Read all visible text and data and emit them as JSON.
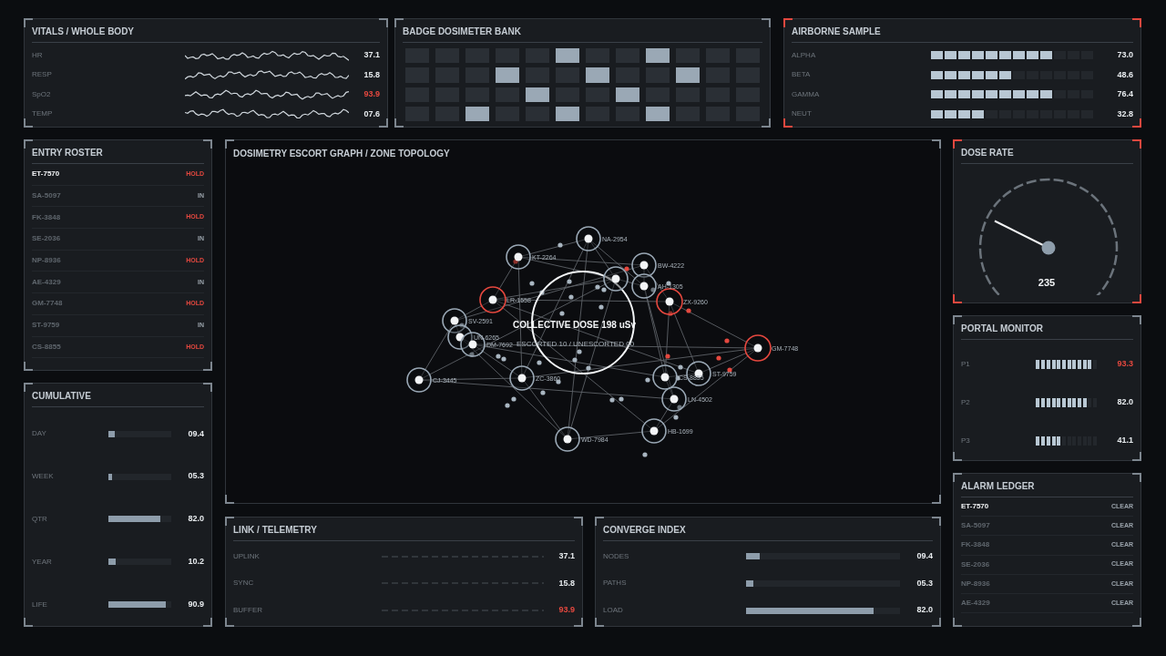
{
  "vitals": {
    "title": "VITALS / WHOLE BODY",
    "alert": false,
    "rows": [
      {
        "label": "HR",
        "value": "37.1",
        "alert": false
      },
      {
        "label": "RESP",
        "value": "15.8",
        "alert": false
      },
      {
        "label": "SpO2",
        "value": "93.9",
        "alert": true
      },
      {
        "label": "TEMP",
        "value": "07.6",
        "alert": false
      }
    ]
  },
  "badge_bank": {
    "title": "BADGE DOSIMETER BANK",
    "alert": false,
    "rows": [
      [
        false,
        false,
        false,
        false,
        false,
        true,
        false,
        false,
        true,
        false,
        false,
        false
      ],
      [
        false,
        false,
        false,
        true,
        false,
        false,
        true,
        false,
        false,
        true,
        false,
        false
      ],
      [
        false,
        false,
        false,
        false,
        true,
        false,
        false,
        true,
        false,
        false,
        false,
        false
      ],
      [
        false,
        false,
        true,
        false,
        false,
        true,
        false,
        false,
        true,
        false,
        false,
        false
      ]
    ]
  },
  "airborne": {
    "title": "AIRBORNE SAMPLE",
    "alert": true,
    "rows": [
      {
        "label": "ALPHA",
        "level": 0.75,
        "value": "73.0"
      },
      {
        "label": "BETA",
        "level": 0.5,
        "value": "48.6"
      },
      {
        "label": "GAMMA",
        "level": 0.75,
        "value": "76.4"
      },
      {
        "label": "NEUT",
        "level": 0.333,
        "value": "32.8"
      }
    ]
  },
  "entry_roster": {
    "title": "ENTRY ROSTER",
    "alert": false,
    "rows": [
      {
        "id": "ET-7570",
        "status": "HOLD",
        "alert": true,
        "selected": true
      },
      {
        "id": "SA-5097",
        "status": "IN",
        "alert": false,
        "selected": false
      },
      {
        "id": "FK-3848",
        "status": "HOLD",
        "alert": true,
        "selected": false
      },
      {
        "id": "SE-2036",
        "status": "IN",
        "alert": false,
        "selected": false
      },
      {
        "id": "NP-8936",
        "status": "HOLD",
        "alert": true,
        "selected": false
      },
      {
        "id": "AE-4329",
        "status": "IN",
        "alert": false,
        "selected": false
      },
      {
        "id": "GM-7748",
        "status": "HOLD",
        "alert": true,
        "selected": false
      },
      {
        "id": "ST-9759",
        "status": "IN",
        "alert": false,
        "selected": false
      },
      {
        "id": "CS-8855",
        "status": "HOLD",
        "alert": true,
        "selected": false
      }
    ]
  },
  "cumulative": {
    "title": "CUMULATIVE",
    "alert": false,
    "rows": [
      {
        "label": "DAY",
        "level": 0.1,
        "value": "09.4"
      },
      {
        "label": "WEEK",
        "level": 0.06,
        "value": "05.3"
      },
      {
        "label": "QTR",
        "level": 0.83,
        "value": "82.0"
      },
      {
        "label": "YEAR",
        "level": 0.11,
        "value": "10.2"
      },
      {
        "label": "LIFE",
        "level": 0.91,
        "value": "90.9"
      }
    ]
  },
  "graph": {
    "title": "DOSIMETRY ESCORT GRAPH / ZONE TOPOLOGY",
    "alert": false,
    "center_title": "COLLECTIVE DOSE 198 uSv",
    "center_subtitle": "ESCORTED 10 / UNESCORTED 00",
    "nodes": [
      {
        "label": "NA-2954",
        "alert": false
      },
      {
        "label": "KT-2264",
        "alert": false
      },
      {
        "label": "BW-4222",
        "alert": false
      },
      {
        "alert": false
      },
      {
        "label": "AH-1305",
        "alert": false
      },
      {
        "label": "LR-1558",
        "alert": true
      },
      {
        "label": "ZX-9260",
        "alert": true
      },
      {
        "label": "SV-2591",
        "alert": false
      },
      {
        "label": "UN-6265",
        "alert": false
      },
      {
        "label": "DM-7692",
        "alert": false
      },
      {
        "label": "CJ-3445",
        "alert": false
      },
      {
        "label": "ZC-3860",
        "alert": false
      },
      {
        "label": "CS-8855",
        "alert": false
      },
      {
        "label": "ST-9759",
        "alert": false
      },
      {
        "label": "GM-7748",
        "alert": true
      },
      {
        "label": "LN-4502",
        "alert": false
      },
      {
        "label": "HB-1699",
        "alert": false
      },
      {
        "label": "WD-7984",
        "alert": false
      }
    ]
  },
  "link_telemetry": {
    "title": "LINK / TELEMETRY",
    "alert": false,
    "rows": [
      {
        "label": "UPLINK",
        "value": "37.1",
        "alert": false
      },
      {
        "label": "SYNC",
        "value": "15.8",
        "alert": false
      },
      {
        "label": "BUFFER",
        "value": "93.9",
        "alert": true
      }
    ]
  },
  "converge_index": {
    "title": "CONVERGE INDEX",
    "alert": false,
    "rows": [
      {
        "label": "NODES",
        "level": 0.09,
        "value": "09.4"
      },
      {
        "label": "PATHS",
        "level": 0.05,
        "value": "05.3"
      },
      {
        "label": "LOAD",
        "level": 0.83,
        "value": "82.0"
      }
    ]
  },
  "dose_rate": {
    "title": "DOSE RATE",
    "alert": true,
    "level": 0.265,
    "value": "235"
  },
  "portal_monitor": {
    "title": "PORTAL MONITOR",
    "alert": false,
    "rows": [
      {
        "label": "P1",
        "level": 0.917,
        "value": "93.3",
        "alert": true
      },
      {
        "label": "P2",
        "level": 0.833,
        "value": "82.0",
        "alert": false
      },
      {
        "label": "P3",
        "level": 0.417,
        "value": "41.1",
        "alert": false
      }
    ]
  },
  "alarm_ledger": {
    "title": "ALARM LEDGER",
    "alert": false,
    "rows": [
      {
        "id": "ET-7570",
        "status": "CLEAR",
        "selected": true
      },
      {
        "id": "SA-5097",
        "status": "CLEAR",
        "selected": false
      },
      {
        "id": "FK-3848",
        "status": "CLEAR",
        "selected": false
      },
      {
        "id": "SE-2036",
        "status": "CLEAR",
        "selected": false
      },
      {
        "id": "NP-8936",
        "status": "CLEAR",
        "selected": false
      },
      {
        "id": "AE-4329",
        "status": "CLEAR",
        "selected": false
      }
    ]
  }
}
